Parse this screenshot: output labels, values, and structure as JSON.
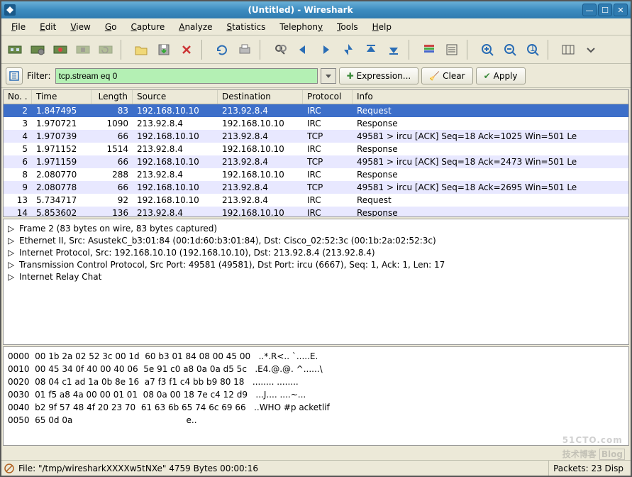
{
  "window": {
    "title": "(Untitled) - Wireshark"
  },
  "menu": {
    "file": "File",
    "edit": "Edit",
    "view": "View",
    "go": "Go",
    "capture": "Capture",
    "analyze": "Analyze",
    "statistics": "Statistics",
    "telephony": "Telephony",
    "tools": "Tools",
    "help": "Help"
  },
  "filter": {
    "label": "Filter:",
    "value": "tcp.stream eq 0",
    "expression_btn": "Expression...",
    "clear_btn": "Clear",
    "apply_btn": "Apply"
  },
  "packet_columns": {
    "no": "No. .",
    "time": "Time",
    "length": "Length",
    "source": "Source",
    "destination": "Destination",
    "protocol": "Protocol",
    "info": "Info"
  },
  "packets": [
    {
      "no": "2",
      "time": "1.847495",
      "len": "83",
      "src": "192.168.10.10",
      "dst": "213.92.8.4",
      "proto": "IRC",
      "info": "Request",
      "sel": true
    },
    {
      "no": "3",
      "time": "1.970721",
      "len": "1090",
      "src": "213.92.8.4",
      "dst": "192.168.10.10",
      "proto": "IRC",
      "info": "Response"
    },
    {
      "no": "4",
      "time": "1.970739",
      "len": "66",
      "src": "192.168.10.10",
      "dst": "213.92.8.4",
      "proto": "TCP",
      "info": "49581 > ircu [ACK] Seq=18 Ack=1025 Win=501 Le"
    },
    {
      "no": "5",
      "time": "1.971152",
      "len": "1514",
      "src": "213.92.8.4",
      "dst": "192.168.10.10",
      "proto": "IRC",
      "info": "Response"
    },
    {
      "no": "6",
      "time": "1.971159",
      "len": "66",
      "src": "192.168.10.10",
      "dst": "213.92.8.4",
      "proto": "TCP",
      "info": "49581 > ircu [ACK] Seq=18 Ack=2473 Win=501 Le"
    },
    {
      "no": "8",
      "time": "2.080770",
      "len": "288",
      "src": "213.92.8.4",
      "dst": "192.168.10.10",
      "proto": "IRC",
      "info": "Response"
    },
    {
      "no": "9",
      "time": "2.080778",
      "len": "66",
      "src": "192.168.10.10",
      "dst": "213.92.8.4",
      "proto": "TCP",
      "info": "49581 > ircu [ACK] Seq=18 Ack=2695 Win=501 Le"
    },
    {
      "no": "13",
      "time": "5.734717",
      "len": "92",
      "src": "192.168.10.10",
      "dst": "213.92.8.4",
      "proto": "IRC",
      "info": "Request"
    },
    {
      "no": "14",
      "time": "5.853602",
      "len": "136",
      "src": "213.92.8.4",
      "dst": "192.168.10.10",
      "proto": "IRC",
      "info": "Response"
    }
  ],
  "details": {
    "l0": "Frame 2 (83 bytes on wire, 83 bytes captured)",
    "l1": "Ethernet II, Src: AsustekC_b3:01:84 (00:1d:60:b3:01:84), Dst: Cisco_02:52:3c (00:1b:2a:02:52:3c)",
    "l2": "Internet Protocol, Src: 192.168.10.10 (192.168.10.10), Dst: 213.92.8.4 (213.92.8.4)",
    "l3": "Transmission Control Protocol, Src Port: 49581 (49581), Dst Port: ircu (6667), Seq: 1, Ack: 1, Len: 17",
    "l4": "Internet Relay Chat"
  },
  "hex": {
    "r0": "0000  00 1b 2a 02 52 3c 00 1d  60 b3 01 84 08 00 45 00   ..*.R<.. `.....E.",
    "r1": "0010  00 45 34 0f 40 00 40 06  5e 91 c0 a8 0a 0a d5 5c   .E4.@.@. ^......\\",
    "r2": "0020  08 04 c1 ad 1a 0b 8e 16  a7 f3 f1 c4 bb b9 80 18   ........ ........",
    "r3": "0030  01 f5 a8 4a 00 00 01 01  08 0a 00 18 7e c4 12 d9   ...J.... ....~...",
    "r4": "0040  b2 9f 57 48 4f 20 23 70  61 63 6b 65 74 6c 69 66   ..WHO #p acketlif",
    "r5": "0050  65 0d 0a                                          e.."
  },
  "status": {
    "file": "File: \"/tmp/wiresharkXXXXw5tNXe\" 4759 Bytes 00:00:16",
    "packets": "Packets: 23 Disp"
  },
  "watermark": {
    "brand": "51CTO.com",
    "sub": "技术博客",
    "blog": "Blog"
  },
  "colors": {
    "filter_bg": "#b4f0b4",
    "sel_row": "#3d6fc9",
    "even_row": "#e8e8ff"
  }
}
